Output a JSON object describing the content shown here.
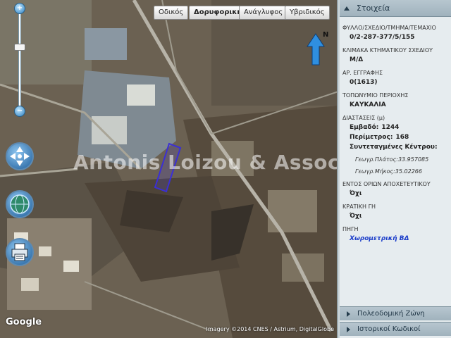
{
  "map": {
    "types": [
      {
        "label": "Οδικός",
        "active": false
      },
      {
        "label": "Δορυφορική",
        "active": true
      },
      {
        "label": "Ανάγλυφος",
        "active": false
      },
      {
        "label": "Υβριδικός",
        "active": false
      }
    ],
    "zoom_in": "+",
    "zoom_out": "−",
    "compass_label": "N",
    "watermark": "Antonis Loizou & Associates",
    "google": "Google",
    "attribution": "Imagery ©2014 CNES / Astrium, DigitalGlobe"
  },
  "panel": {
    "title": "Στοιχεία",
    "fields": {
      "sheet_label": "ΦΥΛΛΟ/ΣΧΕΔΙΟ/ΤΜΗΜΑ/ΤΕΜΑΧΙΟ",
      "sheet_value": "0/2-287-377/5/155",
      "scale_label": "ΚΛΙΜΑΚΑ ΚΤΗΜΑΤΙΚΟΥ ΣΧΕΔΙΟΥ",
      "scale_value": "Μ/Δ",
      "reg_label": "ΑΡ. ΕΓΓΡΑΦΗΣ",
      "reg_value": "0(1613)",
      "place_label": "ΤΟΠΩΝΥΜΙΟ ΠΕΡΙΟΧΗΣ",
      "place_value": "ΚΑΥΚΑΛΙΑ",
      "dims_label": "ΔΙΑΣΤΑΣΕΙΣ (μ)",
      "area_key": "Εμβαδό:",
      "area_value": "1244",
      "perim_key": "Περίμετρος:",
      "perim_value": "168",
      "coords_title": "Συντεταγμένες Κέντρου:",
      "lat": "Γεωγρ.Πλάτος:33.957085",
      "lon": "Γεωγρ.Μήκος:35.02266",
      "sewer_label": "ΕΝΤΟΣ ΟΡΙΩΝ ΑΠΟΧΕΤΕΥΤΙΚΟΥ",
      "sewer_value": "Όχι",
      "state_label": "ΚΡΑΤΙΚΗ ΓΗ",
      "state_value": "Όχι",
      "source_label": "ΠΗΓΗ",
      "source_value": "Χωρομετρική ΒΔ"
    },
    "sections": [
      "Πολεοδομική Ζώνη",
      "Ιστορικοί Κωδικοί"
    ]
  },
  "colors": {
    "accent": "#1d5d9a",
    "panel_bg": "#e6ecef",
    "link_blue": "#1a3cc9",
    "parcel_outline": "#3b2fd6"
  }
}
